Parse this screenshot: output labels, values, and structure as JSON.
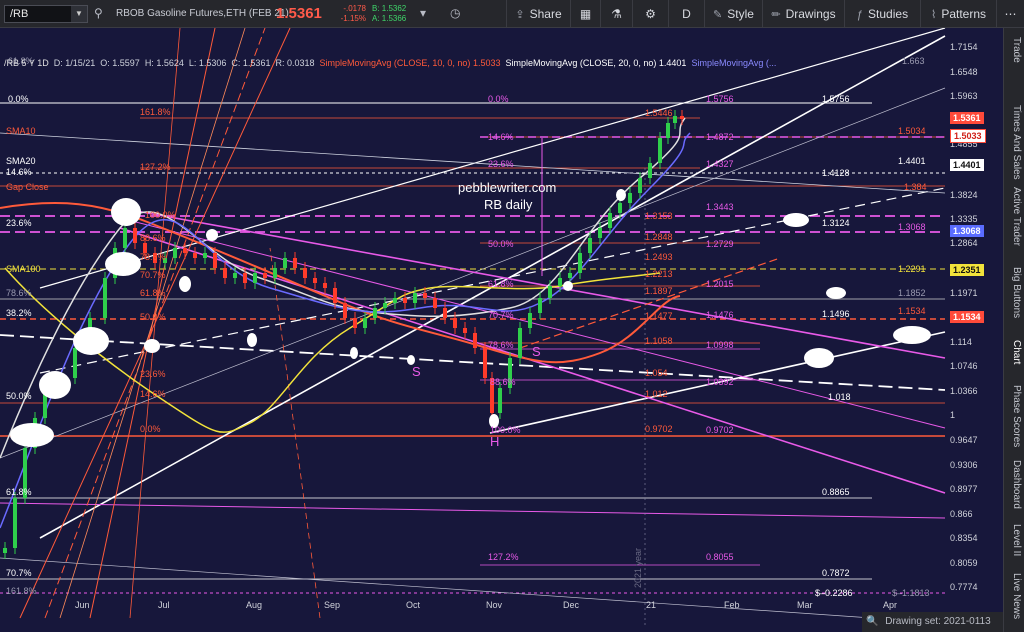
{
  "toolbar": {
    "symbol": "/RB",
    "instrument": "RBOB Gasoline Futures,ETH (FEB 21)",
    "last": "1.5361",
    "change": "-.0178",
    "change_pct": "-1.15%",
    "bid": "B: 1.5362",
    "ask": "A: 1.5366",
    "share": "Share",
    "d": "D",
    "style": "Style",
    "drawings": "Drawings",
    "studies": "Studies",
    "patterns": "Patterns"
  },
  "study_bar": {
    "symbol_period": "/RB 5 Y 1D",
    "date": "D: 1/15/21",
    "open": "O: 1.5597",
    "high": "H: 1.5624",
    "low": "L: 1.5306",
    "close": "C: 1.5361",
    "range": "R: 0.0318",
    "sma10_label": "SimpleMovingAvg (CLOSE, 10, 0, no)",
    "sma10_val": "1.5033",
    "sma20_label": "SimpleMovingAvg (CLOSE, 20, 0, no)",
    "sma20_val": "1.4401",
    "sma_more": "SimpleMovingAvg (..."
  },
  "price_axis": [
    "1.7154",
    "1.6548",
    "1.5963",
    "1.4855",
    "1.4401",
    "1.3824",
    "1.3335",
    "1.2864",
    "1.1971",
    "1.114",
    "1.0746",
    "1.0366",
    "1",
    "0.9647",
    "0.9306",
    "0.8977",
    "0.866",
    "0.8354",
    "0.8059",
    "0.7774"
  ],
  "price_badges": {
    "last": "1.5361",
    "sma10": "1.5033",
    "sma20": "1.4401",
    "blue": "1.3068",
    "yellow": "1.2351",
    "orange": "1.1534"
  },
  "time_axis": [
    "Jun",
    "Jul",
    "Aug",
    "Sep",
    "Oct",
    "Nov",
    "Dec",
    "21",
    "Feb",
    "Mar",
    "Apr"
  ],
  "chart_labels": {
    "watermark_1": "pebblewriter.com",
    "watermark_2": "RB daily",
    "year_mark": "2021 year",
    "left": [
      "61.8%",
      "0.0%",
      "SMA10",
      "SMA20",
      "14.6%",
      "Gap Close",
      "23.6%",
      "38.2%",
      "SMA100",
      "78.6%",
      "38.2%",
      "50.0%",
      "61.8%",
      "70.7%",
      "161.8%"
    ],
    "fib_mid": [
      "161.8%",
      "127.2%",
      "100.0%",
      "88.6%",
      "78.6%",
      "70.7%",
      "61.8%",
      "50.0%",
      "23.6%",
      "14.6%",
      "0.0%"
    ],
    "fib_right": [
      "0.0%",
      "14.6%",
      "23.6%",
      "50.0%",
      "61.8%",
      "70.7%",
      "78.6%",
      "88.6%",
      "100.0%",
      "127.2%"
    ],
    "fib_right_vals": [
      "1.5756",
      "1.4872",
      "1.4327",
      "1.3443",
      "1.2729",
      "1.2015",
      "1.1476",
      "1.0998",
      "1.0392",
      "0.9702",
      "0.8055"
    ],
    "red_vals": [
      "1.5446",
      "1.3153",
      "1.2848",
      "1.2493",
      "1.2213",
      "1.1897",
      "1.1477",
      "1.1058",
      "1.054",
      "1.012",
      "0.9702"
    ],
    "far_right": [
      "1.663",
      "1.5756",
      "1.5034",
      "1.4401",
      "1.4128",
      "1.384",
      "1.3124",
      "1.3068",
      "1.2291",
      "1.1852",
      "1.1534",
      "1.1496",
      "1.018",
      "0.8865",
      "0.7872",
      "0.2286",
      "1.1813"
    ],
    "hs": [
      "S",
      "S",
      "H"
    ]
  },
  "rail": [
    "Trade",
    "Times And Sales",
    "Active Trader",
    "Big Buttons",
    "Chart",
    "Phase Scores",
    "Dashboard",
    "Level II",
    "Live News"
  ],
  "status": {
    "drawing_set": "Drawing set: 2021-0113"
  },
  "colors": {
    "chart_bg": "#17173b",
    "up": "#2fcf4b",
    "down": "#ff3b2a",
    "fib_red": "#ff5a3a",
    "magenta": "#e85ae8",
    "yellow": "#f2e33b"
  }
}
